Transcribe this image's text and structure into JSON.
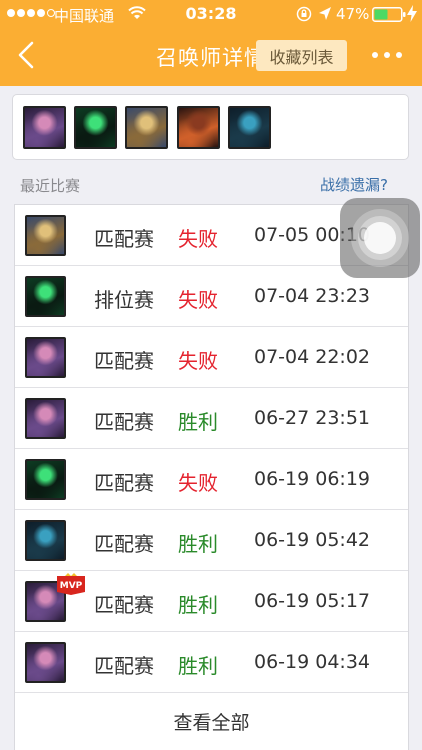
{
  "status_bar": {
    "carrier": "中国联通",
    "time": "03:28",
    "battery": "47%"
  },
  "nav": {
    "title": "召唤师详情",
    "favorites_label": "收藏列表"
  },
  "hero_icons": [
    {
      "name": "hero-pink-mage",
      "palette": [
        "#2a1c3a",
        "#d58ab8",
        "#6a4a8a"
      ]
    },
    {
      "name": "hero-green-shadow",
      "palette": [
        "#0d3b22",
        "#3ee079",
        "#0a1a12"
      ]
    },
    {
      "name": "hero-blonde-champion",
      "palette": [
        "#3a4a6a",
        "#e0c07a",
        "#8a6a3a"
      ]
    },
    {
      "name": "hero-dark-beast",
      "palette": [
        "#2a1410",
        "#8a3a20",
        "#d0602a"
      ]
    },
    {
      "name": "hero-blue-warrior",
      "palette": [
        "#0e1e2a",
        "#3aa0c0",
        "#1a3a4a"
      ]
    }
  ],
  "section": {
    "title": "最近比赛",
    "missing_link": "战绩遗漏?"
  },
  "matches": [
    {
      "hero": "hero-blonde-champion",
      "mode": "匹配赛",
      "result": "失败",
      "outcome": "loss",
      "time": "07-05 00:10",
      "mvp": false
    },
    {
      "hero": "hero-green-shadow",
      "mode": "排位赛",
      "result": "失败",
      "outcome": "loss",
      "time": "07-04 23:23",
      "mvp": false
    },
    {
      "hero": "hero-pink-mage",
      "mode": "匹配赛",
      "result": "失败",
      "outcome": "loss",
      "time": "07-04 22:02",
      "mvp": false
    },
    {
      "hero": "hero-pink-mage",
      "mode": "匹配赛",
      "result": "胜利",
      "outcome": "win",
      "time": "06-27 23:51",
      "mvp": false
    },
    {
      "hero": "hero-green-shadow",
      "mode": "匹配赛",
      "result": "失败",
      "outcome": "loss",
      "time": "06-19 06:19",
      "mvp": false
    },
    {
      "hero": "hero-blue-warrior",
      "mode": "匹配赛",
      "result": "胜利",
      "outcome": "win",
      "time": "06-19 05:42",
      "mvp": false
    },
    {
      "hero": "hero-pink-mage",
      "mode": "匹配赛",
      "result": "胜利",
      "outcome": "win",
      "time": "06-19 05:17",
      "mvp": true,
      "mvp_label": "MVP"
    },
    {
      "hero": "hero-pink-mage",
      "mode": "匹配赛",
      "result": "胜利",
      "outcome": "win",
      "time": "06-19 04:34",
      "mvp": false
    }
  ],
  "view_all_label": "查看全部",
  "colors": {
    "brand": "#fbae33",
    "loss": "#e4232e",
    "win": "#2a8a2a",
    "link": "#3a6fa8"
  }
}
